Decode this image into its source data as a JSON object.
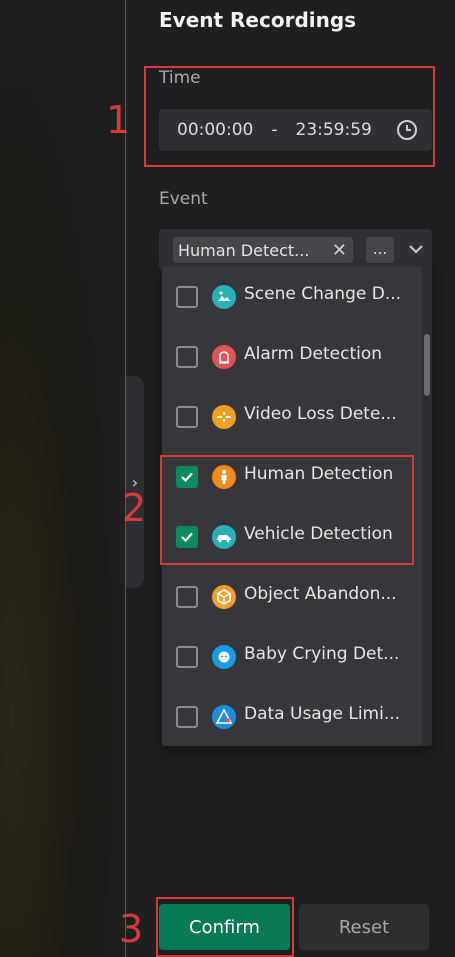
{
  "panel": {
    "title": "Event Recordings"
  },
  "time": {
    "label": "Time",
    "start": "00:00:00",
    "separator": "-",
    "end": "23:59:59",
    "icon": "clock-icon"
  },
  "event": {
    "label": "Event",
    "selected_tag": "Human Detect...",
    "tag_close": "✕",
    "more": "...",
    "options": [
      {
        "label": "Scene Change D...",
        "checked": false,
        "icon": "scene-change-icon",
        "color": "#2ab0b8"
      },
      {
        "label": "Alarm Detection",
        "checked": false,
        "icon": "alarm-icon",
        "color": "#e05555"
      },
      {
        "label": "Video Loss Dete...",
        "checked": false,
        "icon": "video-loss-icon",
        "color": "#f0a020"
      },
      {
        "label": "Human Detection",
        "checked": true,
        "icon": "human-icon",
        "color": "#f08a1c"
      },
      {
        "label": "Vehicle Detection",
        "checked": true,
        "icon": "vehicle-icon",
        "color": "#2ab0b8"
      },
      {
        "label": "Object Abandon...",
        "checked": false,
        "icon": "object-abandon-icon",
        "color": "#f0a030"
      },
      {
        "label": "Baby Crying Det...",
        "checked": false,
        "icon": "baby-crying-icon",
        "color": "#1a9be8"
      },
      {
        "label": "Data Usage Limi...",
        "checked": false,
        "icon": "data-usage-icon",
        "color": "#1a8fe0"
      }
    ]
  },
  "annotations": {
    "one": "1",
    "two": "2",
    "three": "3"
  },
  "buttons": {
    "confirm": "Confirm",
    "reset": "Reset"
  },
  "colors": {
    "accent": "#0a7a56",
    "annotation": "#d63a3a"
  }
}
